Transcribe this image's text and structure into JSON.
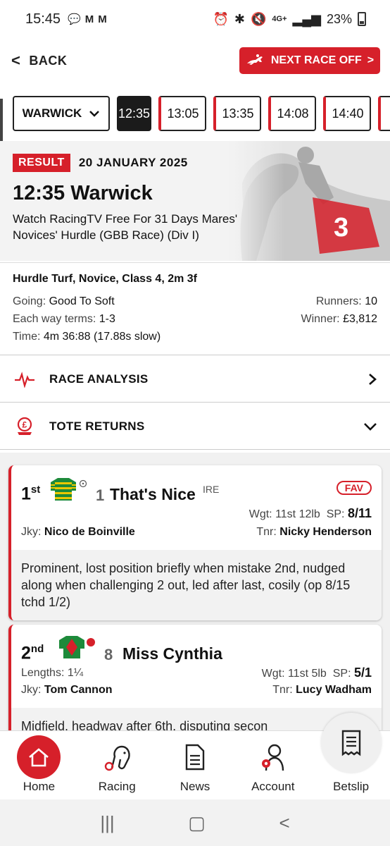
{
  "status": {
    "time": "15:45",
    "network": "4G+",
    "battery": "23%"
  },
  "header": {
    "back_label": "BACK",
    "next_race_label": "NEXT RACE OFF"
  },
  "tabs": {
    "venue": "WARWICK",
    "times": [
      "12:35",
      "13:05",
      "13:35",
      "14:08",
      "14:40"
    ],
    "active_index": 0
  },
  "race": {
    "result_badge": "RESULT",
    "date": "20 JANUARY 2025",
    "title": "12:35 Warwick",
    "name": "Watch RacingTV Free For 31 Days Mares' Novices' Hurdle (GBB Race) (Div I)"
  },
  "details": {
    "class_line": "Hurdle Turf, Novice, Class 4, 2m 3f",
    "going_label": "Going:",
    "going": "Good To Soft",
    "runners_label": "Runners:",
    "runners": "10",
    "each_way_label": "Each way terms:",
    "each_way": "1-3",
    "winner_label": "Winner:",
    "winner": "£3,812",
    "time_label": "Time:",
    "time": "4m 36:88 (17.88s slow)"
  },
  "sections": {
    "race_analysis": "RACE ANALYSIS",
    "tote_returns": "TOTE RETURNS"
  },
  "results": [
    {
      "pos": "1",
      "suffix": "st",
      "cloth": "1",
      "horse": "That's Nice",
      "origin": "IRE",
      "fav": "FAV",
      "weight_label": "Wgt:",
      "weight": "11st 12lb",
      "sp_label": "SP:",
      "sp": "8/11",
      "jockey_label": "Jky:",
      "jockey": "Nico de Boinville",
      "trainer_label": "Tnr:",
      "trainer": "Nicky Henderson",
      "comment": "Prominent, lost position briefly when mistake 2nd, nudged along when challenging 2 out, led after last, cosily (op 8/15 tchd 1/2)"
    },
    {
      "pos": "2",
      "suffix": "nd",
      "cloth": "8",
      "horse": "Miss Cynthia",
      "lengths_label": "Lengths:",
      "lengths": "1¼",
      "weight_label": "Wgt:",
      "weight": "11st 5lb",
      "sp_label": "SP:",
      "sp": "5/1",
      "jockey_label": "Jky:",
      "jockey": "Tom Cannon",
      "trainer_label": "Tnr:",
      "trainer": "Lucy Wadham",
      "comment": "Midfield, headway after 6th, disputing secon"
    }
  ],
  "nav": {
    "home": "Home",
    "racing": "Racing",
    "news": "News",
    "account": "Account",
    "betslip": "Betslip"
  },
  "colors": {
    "accent": "#d6202a",
    "dark": "#1b1b1b"
  }
}
